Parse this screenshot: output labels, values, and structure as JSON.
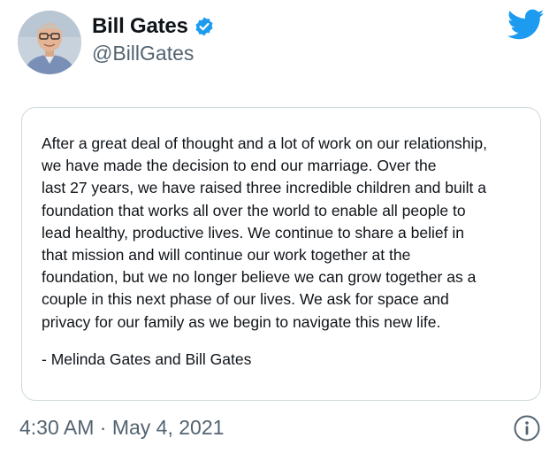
{
  "tweet": {
    "author": {
      "display_name": "Bill Gates",
      "handle": "@BillGates",
      "verified": true,
      "avatar_icon": "profile-avatar"
    },
    "brand_icon": "twitter-bird-icon",
    "brand_color": "#1d9bf0",
    "quoted_statement": {
      "lines": [
        "After a great deal of thought and a lot of work on our relationship,",
        "we have made the decision to end our marriage. Over the",
        "last 27 years, we have raised three incredible children and built a",
        "foundation that works all over the world to enable all people to",
        "lead healthy, productive lives. We continue to share a belief in",
        "that mission and will continue our work together at the",
        "foundation, but we no longer believe we can grow together as a",
        "couple in this next phase of our lives. We ask for space and",
        "privacy for our family as we begin to navigate this new life."
      ],
      "signature": "- Melinda Gates and Bill Gates"
    },
    "timestamp": "4:30 AM · May 4, 2021",
    "info_icon": "info-icon"
  }
}
